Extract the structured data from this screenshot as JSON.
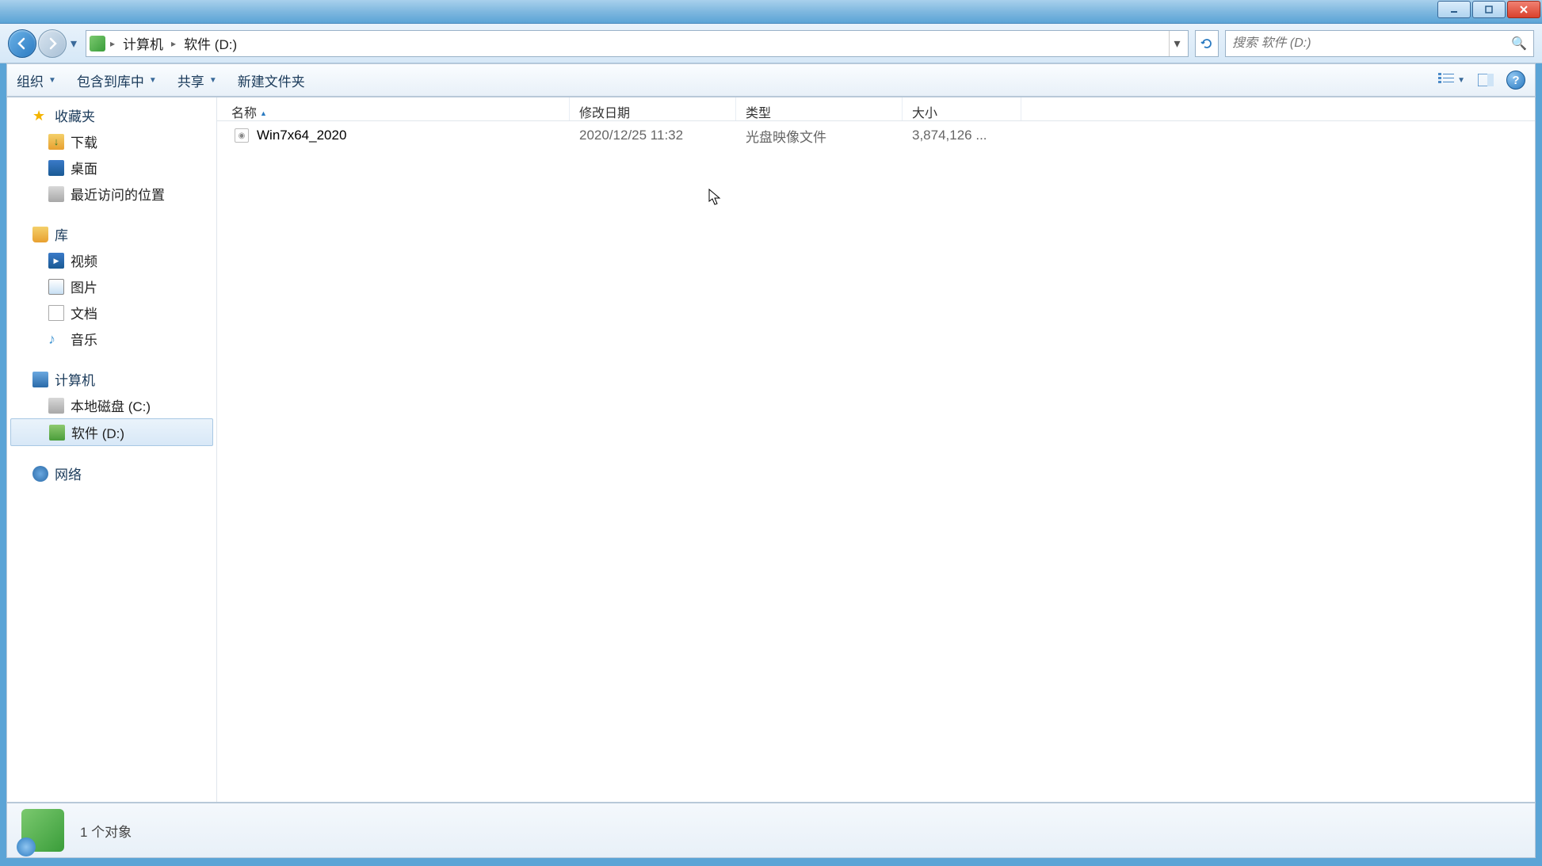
{
  "breadcrumb": {
    "item1": "计算机",
    "item2": "软件 (D:)"
  },
  "search": {
    "placeholder": "搜索 软件 (D:)"
  },
  "toolbar": {
    "organize": "组织",
    "include_in_lib": "包含到库中",
    "share": "共享",
    "new_folder": "新建文件夹"
  },
  "sidebar": {
    "favorites": {
      "label": "收藏夹",
      "downloads": "下载",
      "desktop": "桌面",
      "recent": "最近访问的位置"
    },
    "libraries": {
      "label": "库",
      "videos": "视频",
      "pictures": "图片",
      "documents": "文档",
      "music": "音乐"
    },
    "computer": {
      "label": "计算机",
      "local_c": "本地磁盘 (C:)",
      "soft_d": "软件 (D:)"
    },
    "network": {
      "label": "网络"
    }
  },
  "columns": {
    "name": "名称",
    "date": "修改日期",
    "type": "类型",
    "size": "大小"
  },
  "files": [
    {
      "name": "Win7x64_2020",
      "date": "2020/12/25 11:32",
      "type": "光盘映像文件",
      "size": "3,874,126 ..."
    }
  ],
  "status": {
    "text": "1 个对象"
  }
}
